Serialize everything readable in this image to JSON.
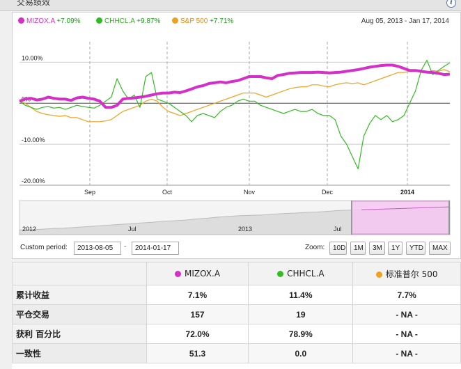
{
  "header": {
    "title": "交易绩效"
  },
  "legend": [
    {
      "name": "MIZOX.A",
      "change": "+7.09%",
      "color": "#d42fc8"
    },
    {
      "name": "CHHCL.A",
      "change": "+9.87%",
      "color": "#33bb22"
    },
    {
      "name": "S&P 500",
      "change": "+7.71%",
      "color": "#f0a020"
    }
  ],
  "date_range": "Aug 05, 2013 - Jan 17, 2014",
  "chart_data": {
    "type": "line",
    "ylim": [
      -20,
      15
    ],
    "y_ticks": [
      "10.00%",
      "0%",
      "-10.00%",
      "-20.00%"
    ],
    "x_ticks": [
      "Sep",
      "Oct",
      "Nov",
      "Dec",
      "2014"
    ],
    "grid": true,
    "series": [
      {
        "name": "MIZOX.A",
        "color": "#d42fc8",
        "values": [
          0.5,
          1.0,
          1.2,
          0.8,
          1.0,
          1.5,
          1.2,
          1.0,
          1.0,
          0.7,
          1.3,
          1.5,
          1.2,
          1.0,
          0.5,
          -1.0,
          -1.0,
          -0.5,
          1.0,
          1.2,
          1.3,
          1.5,
          1.7,
          2.0,
          2.3,
          2.5,
          2.5,
          2.7,
          2.6,
          3.0,
          3.5,
          4.0,
          4.3,
          4.8,
          5.0,
          5.2,
          5.0,
          5.3,
          5.5,
          6.0,
          6.5,
          6.5,
          6.5,
          6.2,
          6.0,
          6.8,
          7.0,
          7.3,
          7.4,
          7.5,
          7.5,
          7.5,
          7.6,
          7.5,
          7.4,
          7.5,
          7.6,
          7.8,
          8.0,
          8.2,
          8.5,
          8.8,
          9.0,
          9.2,
          9.3,
          9.3,
          9.0,
          8.5,
          8.0,
          8.0,
          7.8,
          7.6,
          7.5,
          7.3,
          7.0,
          7.1
        ]
      },
      {
        "name": "CHHCL.A",
        "color": "#33bb22",
        "values": [
          0.5,
          -0.5,
          -1.0,
          -1.5,
          -1.0,
          -0.8,
          -1.2,
          -1.0,
          -1.5,
          -1.0,
          -0.5,
          -0.8,
          -1.0,
          -1.2,
          -0.5,
          0.5,
          1.5,
          6.0,
          3.0,
          1.0,
          2.0,
          -1.0,
          6.5,
          7.5,
          1.0,
          0.5,
          0.0,
          -1.0,
          -2.0,
          -3.0,
          -4.5,
          -3.0,
          -2.5,
          -3.0,
          -3.5,
          -2.0,
          -1.0,
          -0.5,
          0.5,
          1.0,
          0.5,
          0.5,
          -0.5,
          -1.0,
          -1.5,
          -2.0,
          -2.5,
          -2.0,
          -1.5,
          -2.0,
          -2.0,
          -1.5,
          -2.5,
          -3.0,
          -3.0,
          -4.0,
          -8.0,
          -10.0,
          -13.0,
          -16.0,
          -8.0,
          -5.0,
          -3.0,
          -4.0,
          -3.0,
          -4.5,
          -4.0,
          -3.0,
          0.0,
          3.0,
          8.0,
          10.5,
          7.0,
          8.0,
          9.0,
          9.87
        ]
      },
      {
        "name": "S&P 500",
        "color": "#f0a020",
        "values": [
          0.5,
          0.0,
          -1.0,
          -2.0,
          -2.5,
          -2.8,
          -3.0,
          -3.2,
          -3.0,
          -3.5,
          -3.5,
          -4.0,
          -4.5,
          -4.5,
          -4.5,
          -4.3,
          -4.0,
          -3.0,
          -2.0,
          -1.5,
          -1.0,
          -0.5,
          0.5,
          1.0,
          0.5,
          -1.0,
          -2.0,
          -2.5,
          -3.0,
          -2.5,
          -2.0,
          -1.5,
          -1.0,
          -0.5,
          0.0,
          0.5,
          1.0,
          1.5,
          2.0,
          2.5,
          2.5,
          2.5,
          2.0,
          1.5,
          2.0,
          2.5,
          3.0,
          3.5,
          3.8,
          4.0,
          4.0,
          4.5,
          4.5,
          4.2,
          4.0,
          4.5,
          4.8,
          5.0,
          4.8,
          5.0,
          4.5,
          5.0,
          5.5,
          6.0,
          6.5,
          7.0,
          7.5,
          7.5,
          7.8,
          8.0,
          7.5,
          7.5,
          8.0,
          7.8,
          8.2,
          7.71
        ]
      }
    ]
  },
  "navigator": {
    "labels": [
      "2012",
      "Jul",
      "2013",
      "Jul"
    ],
    "values": [
      0.5,
      0.6,
      0.7,
      0.9,
      1.0,
      1.2,
      1.4,
      1.6,
      1.8,
      2.0,
      2.2,
      2.4,
      2.6,
      2.9,
      3.0,
      3.2,
      3.5,
      3.7,
      4.0,
      4.2,
      4.4,
      4.5,
      4.6,
      4.8,
      5.0,
      5.1,
      5.3,
      5.4,
      5.6,
      5.8,
      5.9,
      6.0,
      6.1,
      6.2,
      6.3,
      6.4,
      6.5,
      6.6,
      6.7,
      6.8
    ]
  },
  "controls": {
    "custom_period_label": "Custom period:",
    "start_date": "2013-08-05",
    "dash": "-",
    "end_date": "2014-01-17",
    "zoom_label": "Zoom:",
    "zoom_buttons": [
      "10D",
      "1M",
      "3M",
      "1Y",
      "YTD",
      "MAX"
    ]
  },
  "table": {
    "headers": [
      {
        "name": "MIZOX.A",
        "color": "#d42fc8"
      },
      {
        "name": "CHHCL.A",
        "color": "#33bb22"
      },
      {
        "name": "标准普尔  500",
        "color": "#f0a020"
      }
    ],
    "rows": [
      {
        "label": "累计收益",
        "values": [
          "7.1%",
          "11.4%",
          "7.7%"
        ]
      },
      {
        "label": "平仓交易",
        "values": [
          "157",
          "19",
          "- NA -"
        ]
      },
      {
        "label": "获利  百分比",
        "values": [
          "72.0%",
          "78.9%",
          "- NA -"
        ]
      },
      {
        "label": "一致性",
        "values": [
          "51.3",
          "0.0",
          "- NA -"
        ]
      }
    ]
  }
}
